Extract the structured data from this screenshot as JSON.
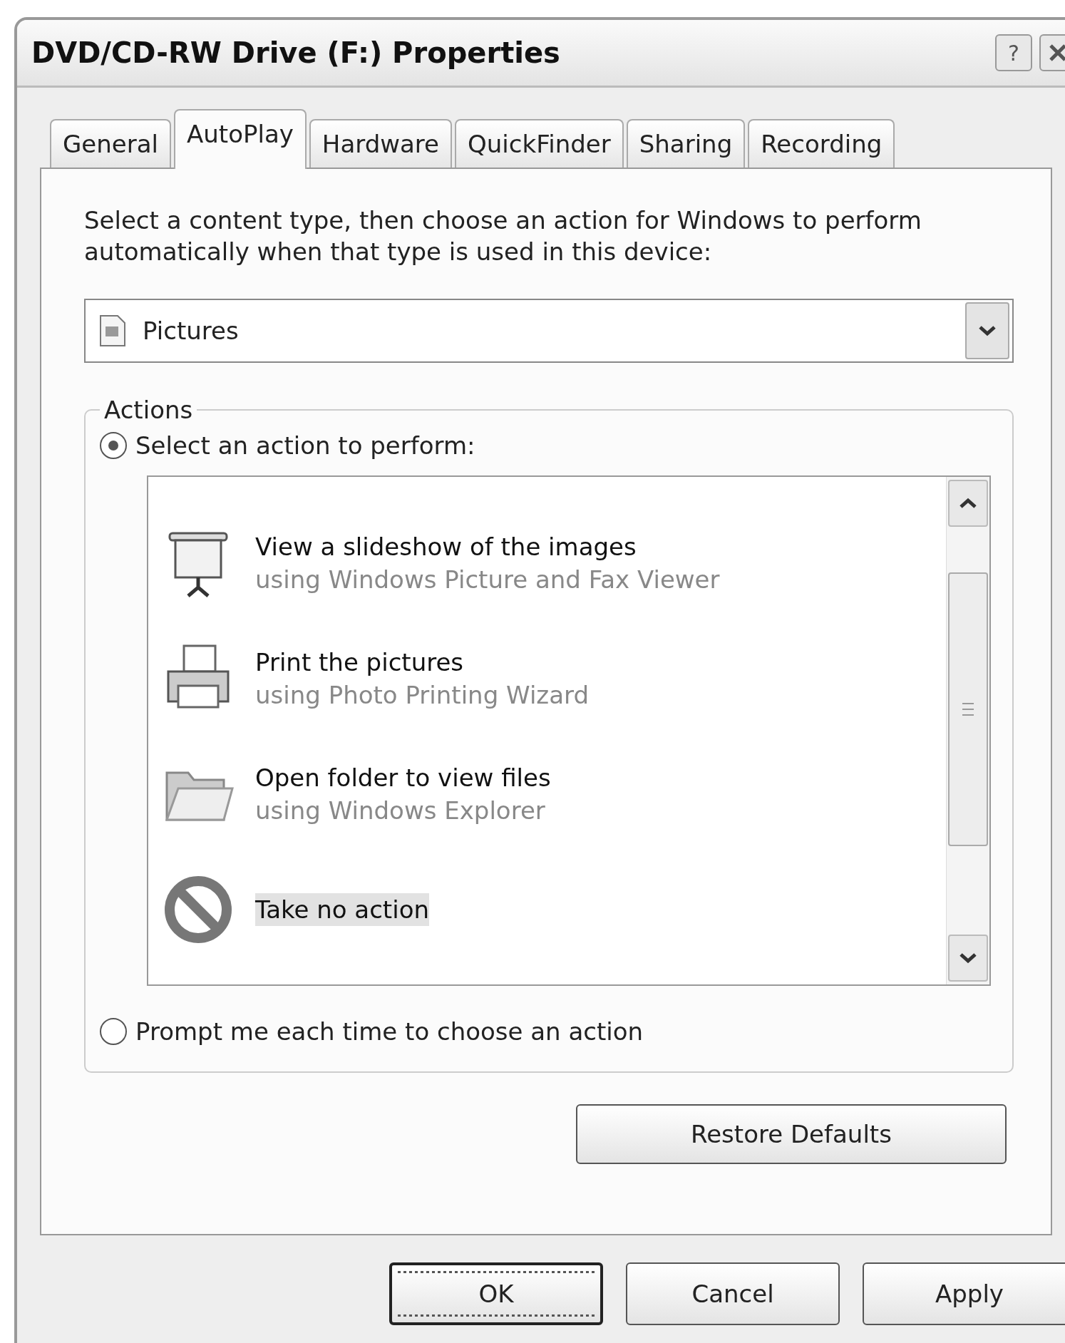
{
  "window": {
    "title": "DVD/CD-RW Drive (F:) Properties",
    "help_button": "?"
  },
  "tabs": [
    {
      "label": "General",
      "selected": false
    },
    {
      "label": "AutoPlay",
      "selected": true
    },
    {
      "label": "Hardware",
      "selected": false
    },
    {
      "label": "QuickFinder",
      "selected": false
    },
    {
      "label": "Sharing",
      "selected": false
    },
    {
      "label": "Recording",
      "selected": false
    }
  ],
  "description": "Select a content type, then choose an action for Windows to perform automatically when that type is used in this device:",
  "content_type": {
    "value": "Pictures"
  },
  "actions": {
    "title": "Actions",
    "options": [
      {
        "label": "Select an action to perform:",
        "selected": true
      },
      {
        "label": "Prompt me each time to choose an action",
        "selected": false
      }
    ],
    "items": [
      {
        "kind": "slideshow",
        "title": "View a slideshow of the images",
        "subtitle": "using Windows Picture and Fax Viewer",
        "selected": false
      },
      {
        "kind": "printer",
        "title": "Print the pictures",
        "subtitle": "using Photo Printing Wizard",
        "selected": false
      },
      {
        "kind": "folder",
        "title": "Open folder to view files",
        "subtitle": "using Windows Explorer",
        "selected": false
      },
      {
        "kind": "none",
        "title": "Take no action",
        "selected": true
      }
    ]
  },
  "restore_button": "Restore Defaults",
  "buttons": [
    {
      "label": "OK",
      "focused": true
    },
    {
      "label": "Cancel",
      "focused": false
    },
    {
      "label": "Apply",
      "focused": false
    }
  ]
}
